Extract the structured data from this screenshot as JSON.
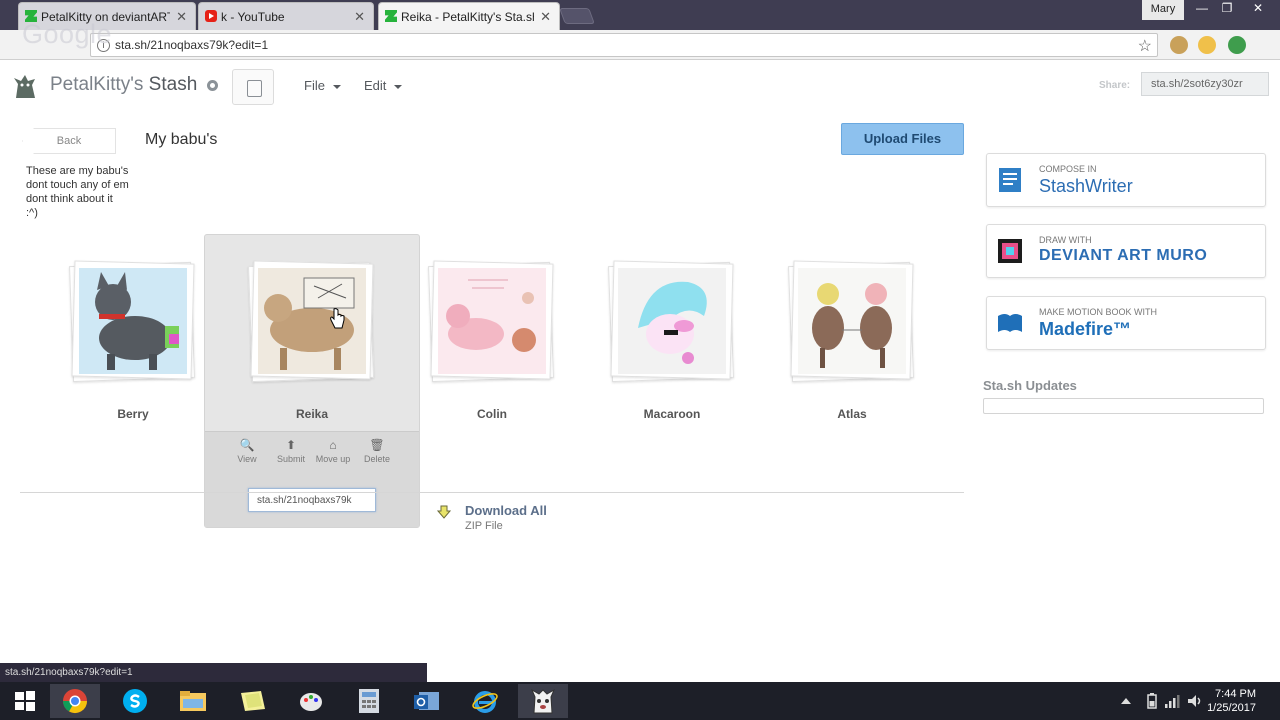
{
  "browser": {
    "tabs": [
      {
        "title": "PetalKitty on deviantART",
        "favicon": "deviantart-icon",
        "active": false
      },
      {
        "title": "k - YouTube",
        "favicon": "youtube-icon",
        "active": false
      },
      {
        "title": "Reika - PetalKitty's Sta.sh",
        "favicon": "deviantart-icon",
        "active": true
      }
    ],
    "tab_close": "✕",
    "profile_name": "Mary",
    "window_buttons": {
      "minimize": "—",
      "restore": "❐",
      "close": "✕"
    },
    "watermark": "Google",
    "url": "sta.sh/21noqbaxs79k?edit=1",
    "bookmark_star": "☆",
    "info_glyph": "i"
  },
  "stash": {
    "brand_owner": "PetalKitty's",
    "brand_product": "Stash",
    "menus": [
      "File",
      "Edit"
    ],
    "share_label": "Share:",
    "share_url": "sta.sh/2sot6zy30zr"
  },
  "folder": {
    "back_label": "Back",
    "title": "My babu's",
    "description": "These are my babu's\ndont touch any of em\ndont think about it\n:^)",
    "upload_label": "Upload Files"
  },
  "items": [
    {
      "name": "Berry"
    },
    {
      "name": "Reika",
      "selected": true
    },
    {
      "name": "Colin"
    },
    {
      "name": "Macaroon"
    },
    {
      "name": "Atlas"
    }
  ],
  "selected_actions": [
    {
      "label": "View",
      "icon": "magnifier-icon",
      "glyph": "🔍"
    },
    {
      "label": "Submit",
      "icon": "upload-arrow-icon",
      "glyph": "⬆"
    },
    {
      "label": "Move up",
      "icon": "house-arrow-icon",
      "glyph": "⌂"
    },
    {
      "label": "Delete",
      "icon": "trash-icon",
      "glyph": "🗑"
    }
  ],
  "selected_link": "sta.sh/21noqbaxs79k",
  "download": {
    "title": "Download All",
    "subtitle": "ZIP File"
  },
  "promos": [
    {
      "small": "COMPOSE IN",
      "big": "StashWriter",
      "icon": "stashwriter-icon"
    },
    {
      "small": "DRAW WITH",
      "big": "DEVIANT ART MURO",
      "icon": "muro-icon"
    },
    {
      "small": "MAKE MOTION BOOK WITH",
      "big": "Madefire™",
      "icon": "madefire-icon"
    }
  ],
  "updates_title": "Sta.sh Updates",
  "status_url": "sta.sh/21noqbaxs79k?edit=1",
  "clock": {
    "time": "7:44 PM",
    "date": "1/25/2017"
  },
  "colors": {
    "accent": "#8dc1ee",
    "brand_green": "#27b33c",
    "promo_blue": "#2c6db3"
  }
}
